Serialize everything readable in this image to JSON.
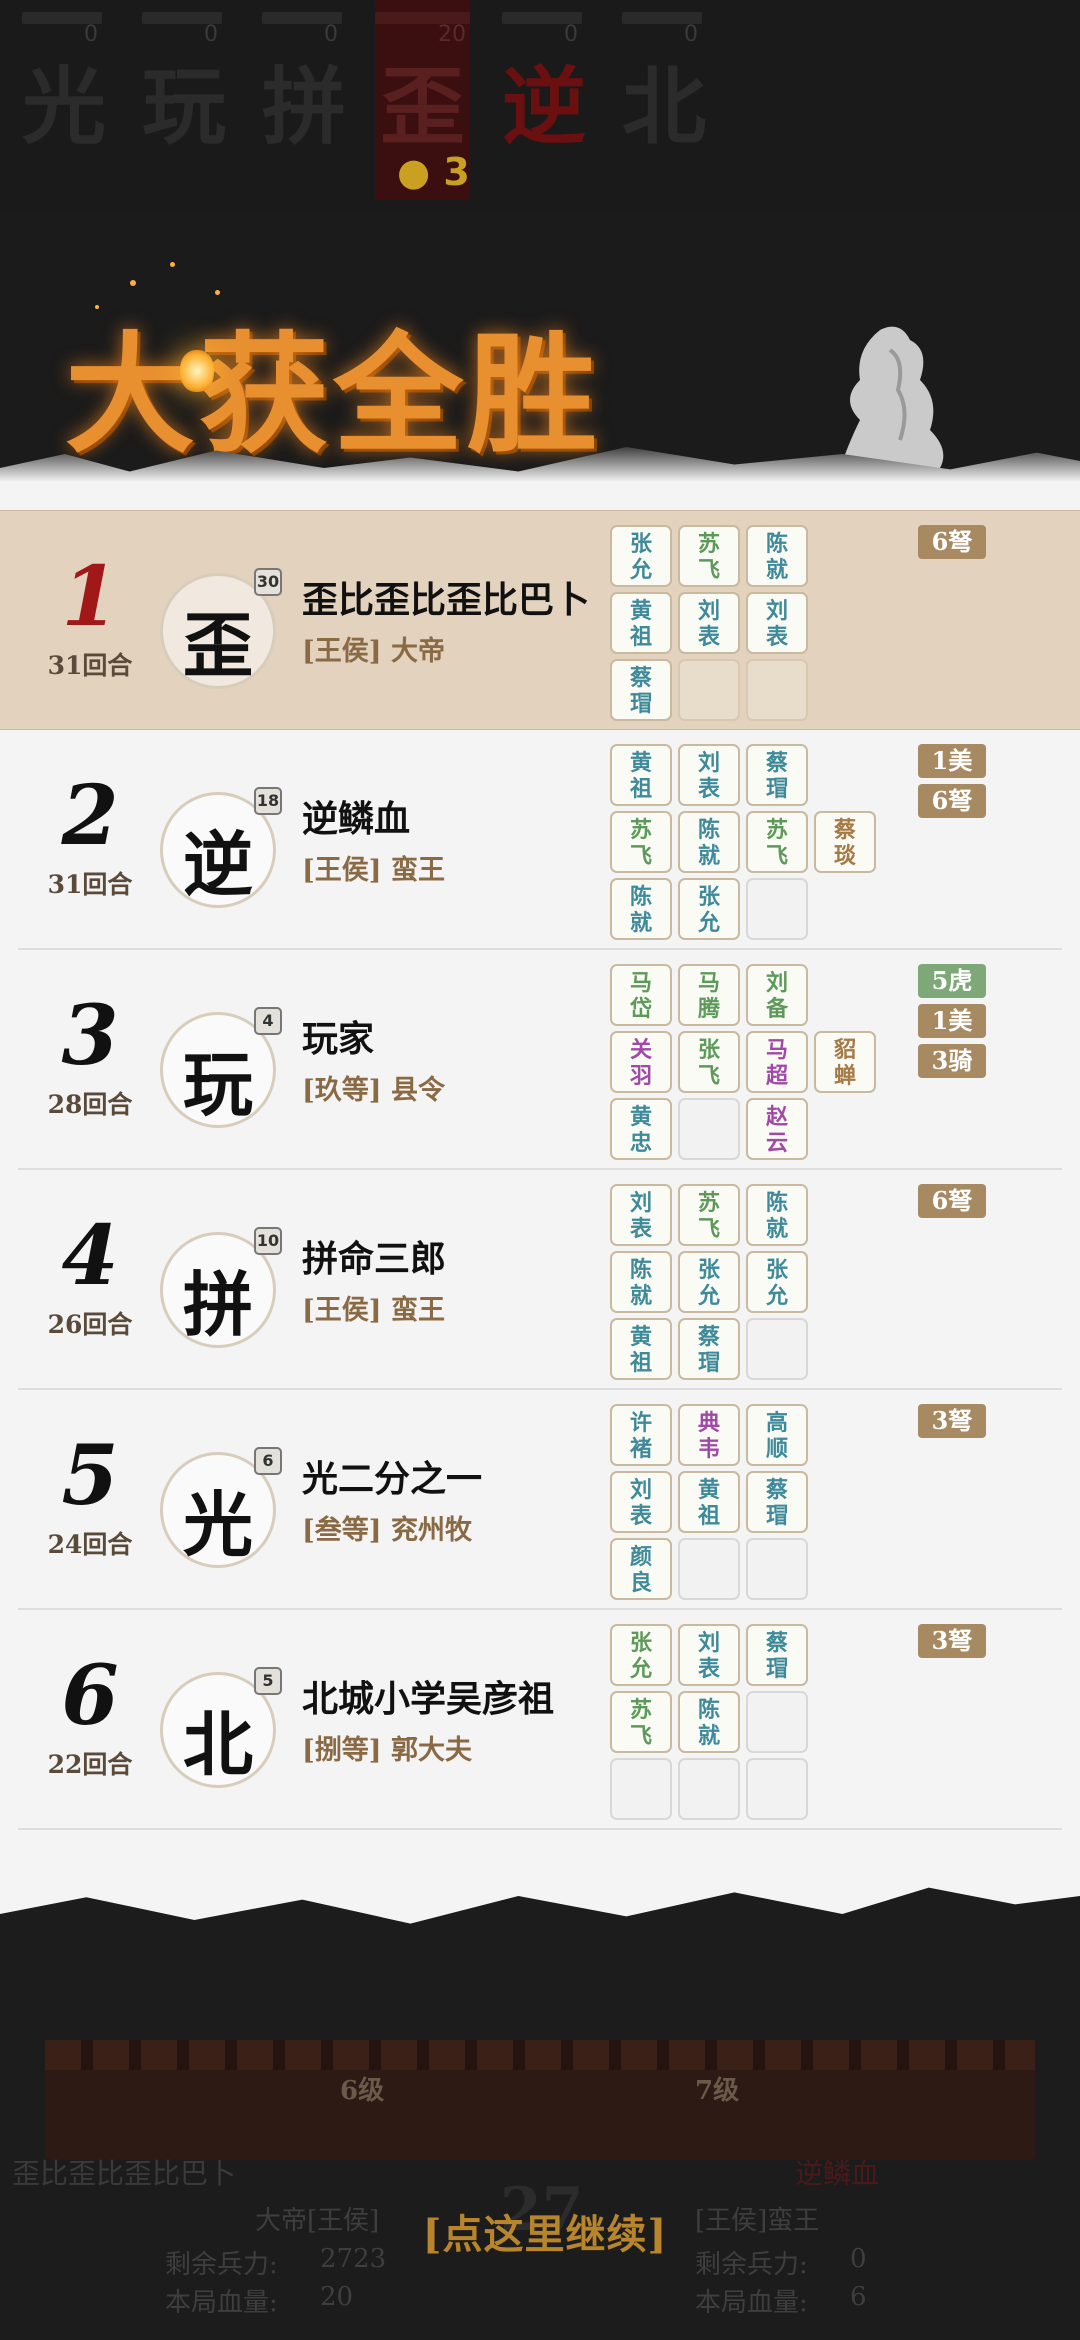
{
  "top_players": [
    {
      "char": "光",
      "count": "0",
      "active": false,
      "red": false
    },
    {
      "char": "玩",
      "count": "0",
      "active": false,
      "red": false
    },
    {
      "char": "拼",
      "count": "0",
      "active": false,
      "red": false
    },
    {
      "char": "歪",
      "count": "20",
      "active": true,
      "red": false,
      "coin": "● 3"
    },
    {
      "char": "逆",
      "count": "0",
      "active": false,
      "red": true
    },
    {
      "char": "北",
      "count": "0",
      "active": false,
      "red": false
    }
  ],
  "banner": {
    "title": "大获全胜"
  },
  "rankings": [
    {
      "rank": "1",
      "rounds": "31回合",
      "avatar_char": "歪",
      "level": "30",
      "name": "歪比歪比歪比巴卜",
      "title": "[王侯] 大帝",
      "cards": [
        {
          "t": "张允",
          "c": "blue"
        },
        {
          "t": "苏飞",
          "c": "green"
        },
        {
          "t": "陈就",
          "c": "blue"
        },
        {
          "t": "黄祖",
          "c": "blue"
        },
        {
          "t": "刘表",
          "c": "blue"
        },
        {
          "t": "刘表",
          "c": "blue"
        },
        {
          "t": "蔡瑁",
          "c": "blue"
        },
        {
          "t": "",
          "c": "empty"
        },
        {
          "t": "",
          "c": "empty"
        }
      ],
      "tags": [
        {
          "t": "6弩",
          "c": "brown"
        }
      ]
    },
    {
      "rank": "2",
      "rounds": "31回合",
      "avatar_char": "逆",
      "level": "18",
      "name": "逆鳞血",
      "title": "[王侯] 蛮王",
      "cards": [
        {
          "t": "黄祖",
          "c": "blue"
        },
        {
          "t": "刘表",
          "c": "blue"
        },
        {
          "t": "蔡瑁",
          "c": "blue"
        },
        {
          "t": "苏飞",
          "c": "green"
        },
        {
          "t": "陈就",
          "c": "blue"
        },
        {
          "t": "苏飞",
          "c": "green"
        },
        {
          "t": "陈就",
          "c": "blue"
        },
        {
          "t": "张允",
          "c": "blue"
        },
        {
          "t": "",
          "c": "empty"
        }
      ],
      "extra": {
        "t": "蔡琰",
        "c": "brown"
      },
      "tags": [
        {
          "t": "1美",
          "c": "brown"
        },
        {
          "t": "6弩",
          "c": "brown"
        }
      ]
    },
    {
      "rank": "3",
      "rounds": "28回合",
      "avatar_char": "玩",
      "level": "4",
      "name": "玩家",
      "title": "[玖等] 县令",
      "cards": [
        {
          "t": "马岱",
          "c": "green"
        },
        {
          "t": "马腾",
          "c": "green"
        },
        {
          "t": "刘备",
          "c": "green"
        },
        {
          "t": "关羽",
          "c": "purple"
        },
        {
          "t": "张飞",
          "c": "green"
        },
        {
          "t": "马超",
          "c": "purple"
        },
        {
          "t": "黄忠",
          "c": "blue"
        },
        {
          "t": "",
          "c": "empty"
        },
        {
          "t": "赵云",
          "c": "purple"
        }
      ],
      "extra": {
        "t": "貂蝉",
        "c": "brown"
      },
      "tags": [
        {
          "t": "5虎",
          "c": "green"
        },
        {
          "t": "1美",
          "c": "brown"
        },
        {
          "t": "3骑",
          "c": "brown"
        }
      ]
    },
    {
      "rank": "4",
      "rounds": "26回合",
      "avatar_char": "拼",
      "level": "10",
      "name": "拼命三郎",
      "title": "[王侯] 蛮王",
      "cards": [
        {
          "t": "刘表",
          "c": "blue"
        },
        {
          "t": "苏飞",
          "c": "green"
        },
        {
          "t": "陈就",
          "c": "blue"
        },
        {
          "t": "陈就",
          "c": "blue"
        },
        {
          "t": "张允",
          "c": "blue"
        },
        {
          "t": "张允",
          "c": "blue"
        },
        {
          "t": "黄祖",
          "c": "blue"
        },
        {
          "t": "蔡瑁",
          "c": "blue"
        },
        {
          "t": "",
          "c": "empty"
        }
      ],
      "tags": [
        {
          "t": "6弩",
          "c": "brown"
        }
      ]
    },
    {
      "rank": "5",
      "rounds": "24回合",
      "avatar_char": "光",
      "level": "6",
      "name": "光二分之一",
      "title": "[叁等] 兖州牧",
      "cards": [
        {
          "t": "许褚",
          "c": "blue"
        },
        {
          "t": "典韦",
          "c": "purple"
        },
        {
          "t": "高顺",
          "c": "blue"
        },
        {
          "t": "刘表",
          "c": "blue"
        },
        {
          "t": "黄祖",
          "c": "blue"
        },
        {
          "t": "蔡瑁",
          "c": "blue"
        },
        {
          "t": "颜良",
          "c": "blue"
        },
        {
          "t": "",
          "c": "empty"
        },
        {
          "t": "",
          "c": "empty"
        }
      ],
      "tags": [
        {
          "t": "3弩",
          "c": "brown"
        }
      ]
    },
    {
      "rank": "6",
      "rounds": "22回合",
      "avatar_char": "北",
      "level": "5",
      "name": "北城小学吴彦祖",
      "title": "[捌等] 郭大夫",
      "cards": [
        {
          "t": "张允",
          "c": "green"
        },
        {
          "t": "刘表",
          "c": "blue"
        },
        {
          "t": "蔡瑁",
          "c": "blue"
        },
        {
          "t": "苏飞",
          "c": "green"
        },
        {
          "t": "陈就",
          "c": "blue"
        },
        {
          "t": "",
          "c": "empty"
        },
        {
          "t": "",
          "c": "empty"
        },
        {
          "t": "",
          "c": "empty"
        },
        {
          "t": "",
          "c": "empty"
        }
      ],
      "tags": [
        {
          "t": "3弩",
          "c": "brown"
        }
      ]
    }
  ],
  "bottom": {
    "left_level": "6级",
    "right_level": "7级",
    "left_name": "歪比歪比歪比巴卜",
    "left_title": "大帝[王侯]",
    "left_troops_label": "剩余兵力:",
    "left_troops": "2723",
    "left_hp_label": "本局血量:",
    "left_hp": "20",
    "right_name": "逆鳞血",
    "right_title": "[王侯]蛮王",
    "right_troops_label": "剩余兵力:",
    "right_troops": "0",
    "right_hp_label": "本局血量:",
    "right_hp": "6",
    "center_number": "27",
    "continue_label": "[点这里继续]"
  }
}
